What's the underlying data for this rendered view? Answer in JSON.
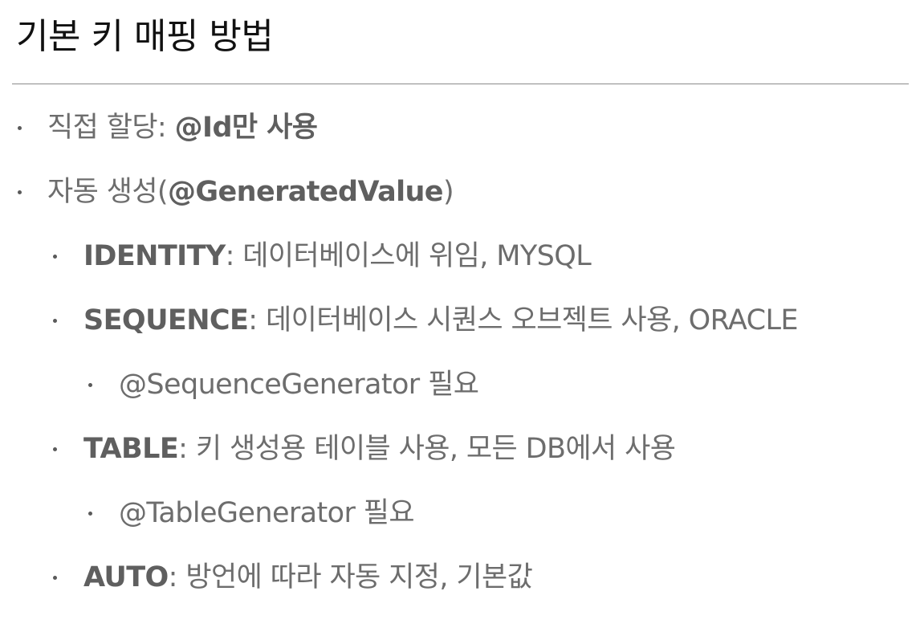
{
  "title": "기본 키 매핑 방법",
  "bullets": [
    {
      "bold_prefix": "",
      "plain_prefix": "직접 할당: ",
      "bold": "@Id만 사용",
      "rest": ""
    },
    {
      "bold_prefix": "",
      "plain_prefix": "자동 생성(",
      "bold": "@GeneratedValue",
      "rest": ")"
    },
    {
      "bold": "IDENTITY",
      "rest": ": 데이터베이스에 위임, MYSQL"
    },
    {
      "bold": "SEQUENCE",
      "rest": ": 데이터베이스 시퀀스 오브젝트 사용, ORACLE"
    },
    {
      "text": "@SequenceGenerator 필요"
    },
    {
      "bold": "TABLE",
      "rest": ": 키 생성용 테이블 사용, 모든 DB에서 사용"
    },
    {
      "text": "@TableGenerator 필요"
    },
    {
      "bold": "AUTO",
      "rest": ": 방언에 따라 자동 지정, 기본값"
    }
  ]
}
